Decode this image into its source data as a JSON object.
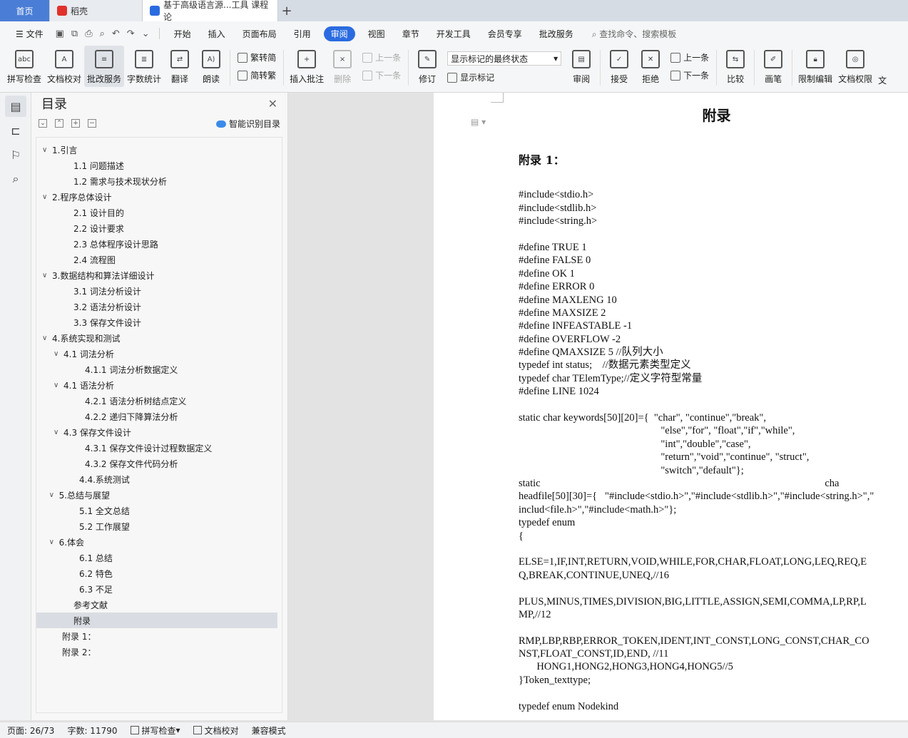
{
  "tabs": {
    "home": "首页",
    "daoke": "稻壳",
    "doc": "基于高级语言源...工具 课程论",
    "add": "+"
  },
  "menu": {
    "file": "文件",
    "items": [
      "开始",
      "插入",
      "页面布局",
      "引用",
      "审阅",
      "视图",
      "章节",
      "开发工具",
      "会员专享",
      "批改服务"
    ],
    "active": "审阅",
    "search": "查找命令、搜索模板"
  },
  "ribbon": {
    "spell": "拼写检查",
    "proof": "文档校对",
    "correct": "批改服务",
    "wordcount": "字数统计",
    "translate": "翻译",
    "read": "朗读",
    "trad": "繁转简",
    "simp": "简转繁",
    "insert_comment": "插入批注",
    "delete": "删除",
    "prev": "上一条",
    "next": "下一条",
    "revise": "修订",
    "markup_state": "显示标记的最终状态",
    "show_markup": "显示标记",
    "review": "审阅",
    "accept": "接受",
    "reject": "拒绝",
    "prev2": "上一条",
    "next2": "下一条",
    "compare": "比较",
    "pen": "画笔",
    "restrict": "限制编辑",
    "doc_perm": "文档权限",
    "cut": "文"
  },
  "toc": {
    "title": "目录",
    "ai": "智能识别目录",
    "items": [
      {
        "t": "1.引言",
        "lv": 0,
        "c": true
      },
      {
        "t": "1.1 问题描述",
        "lv": 1
      },
      {
        "t": "1.2 需求与技术现状分析",
        "lv": 1
      },
      {
        "t": "2.程序总体设计",
        "lv": 0,
        "c": true
      },
      {
        "t": "2.1 设计目的",
        "lv": 1
      },
      {
        "t": "2.2 设计要求",
        "lv": 1
      },
      {
        "t": "2.3 总体程序设计思路",
        "lv": 1
      },
      {
        "t": "2.4 流程图",
        "lv": 1
      },
      {
        "t": "3.数据结构和算法详细设计",
        "lv": 0,
        "c": true
      },
      {
        "t": "3.1 词法分析设计",
        "lv": 1
      },
      {
        "t": "3.2 语法分析设计",
        "lv": 1
      },
      {
        "t": "3.3 保存文件设计",
        "lv": 1
      },
      {
        "t": "4.系统实现和测试",
        "lv": 0,
        "c": true
      },
      {
        "t": "4.1 词法分析",
        "lv": 1,
        "c": true
      },
      {
        "t": "4.1.1 词法分析数据定义",
        "lv": 2
      },
      {
        "t": "4.1 语法分析",
        "lv": 1,
        "c": true
      },
      {
        "t": "4.2.1 语法分析树结点定义",
        "lv": 2
      },
      {
        "t": "4.2.2 递归下降算法分析",
        "lv": 2
      },
      {
        "t": "4.3 保存文件设计",
        "lv": 1,
        "c": true
      },
      {
        "t": "4.3.1 保存文件设计过程数据定义",
        "lv": 2
      },
      {
        "t": "4.3.2 保存文件代码分析",
        "lv": 2
      },
      {
        "t": "4.4.系统测试",
        "lv": 1.5
      },
      {
        "t": "5.总结与展望",
        "lv": 0.6,
        "c": true
      },
      {
        "t": "5.1 全文总结",
        "lv": 1.5
      },
      {
        "t": "5.2 工作展望",
        "lv": 1.5
      },
      {
        "t": "6.体会",
        "lv": 0.6,
        "c": true
      },
      {
        "t": "6.1 总结",
        "lv": 1.5
      },
      {
        "t": "6.2 特色",
        "lv": 1.5
      },
      {
        "t": "6.3 不足",
        "lv": 1.5
      },
      {
        "t": "参考文献",
        "lv": 1
      },
      {
        "t": "附录",
        "lv": 1,
        "sel": true
      },
      {
        "t": "附录 1：",
        "lv": 0
      },
      {
        "t": "附录 2：",
        "lv": 0
      }
    ]
  },
  "doc": {
    "title": "附录",
    "heading": "附录 1：",
    "lines": [
      "#include<stdio.h>",
      "#include<stdlib.h>",
      "#include<string.h>",
      "",
      "#define TRUE 1",
      "#define FALSE 0",
      "#define OK 1",
      "#define ERROR 0",
      "#define MAXLENG 10",
      "#define MAXSIZE 2",
      "#define INFEASTABLE -1",
      "#define OVERFLOW -2",
      "#define QMAXSIZE 5 //队列大小",
      "typedef int status;    //数据元素类型定义",
      "typedef char TElemType;//定义字符型常量",
      "#define LINE 1024",
      "",
      "static char keywords[50][20]={  \"char\", \"continue\",\"break\",",
      "                                                       \"else\",\"for\", \"float\",\"if\",\"while\",",
      "                                                       \"int\",\"double\",\"case\",",
      "                                                       \"return\",\"void\",\"continue\", \"struct\",",
      "                                                       \"switch\",\"default\"};",
      "static                                                                                                              cha",
      "headfile[50][30]={   \"#include<stdio.h>\",\"#include<stdlib.h>\",\"#include<string.h>\",\"",
      "includ<file.h>\",\"#include<math.h>\"};",
      "typedef enum",
      "{",
      "",
      "ELSE=1,IF,INT,RETURN,VOID,WHILE,FOR,CHAR,FLOAT,LONG,LEQ,REQ,E",
      "Q,BREAK,CONTINUE,UNEQ,//16",
      "",
      "PLUS,MINUS,TIMES,DIVISION,BIG,LITTLE,ASSIGN,SEMI,COMMA,LP,RP,L",
      "MP,//12",
      "",
      "RMP,LBP,RBP,ERROR_TOKEN,IDENT,INT_CONST,LONG_CONST,CHAR_CO",
      "NST,FLOAT_CONST,ID,END, //11",
      "       HONG1,HONG2,HONG3,HONG4,HONG5//5",
      "}Token_texttype;",
      "",
      "typedef enum Nodekind"
    ]
  },
  "status": {
    "page": "页面: 26/73",
    "words": "字数: 11790",
    "spell": "拼写检查",
    "proof": "文档校对",
    "compat": "兼容模式"
  }
}
